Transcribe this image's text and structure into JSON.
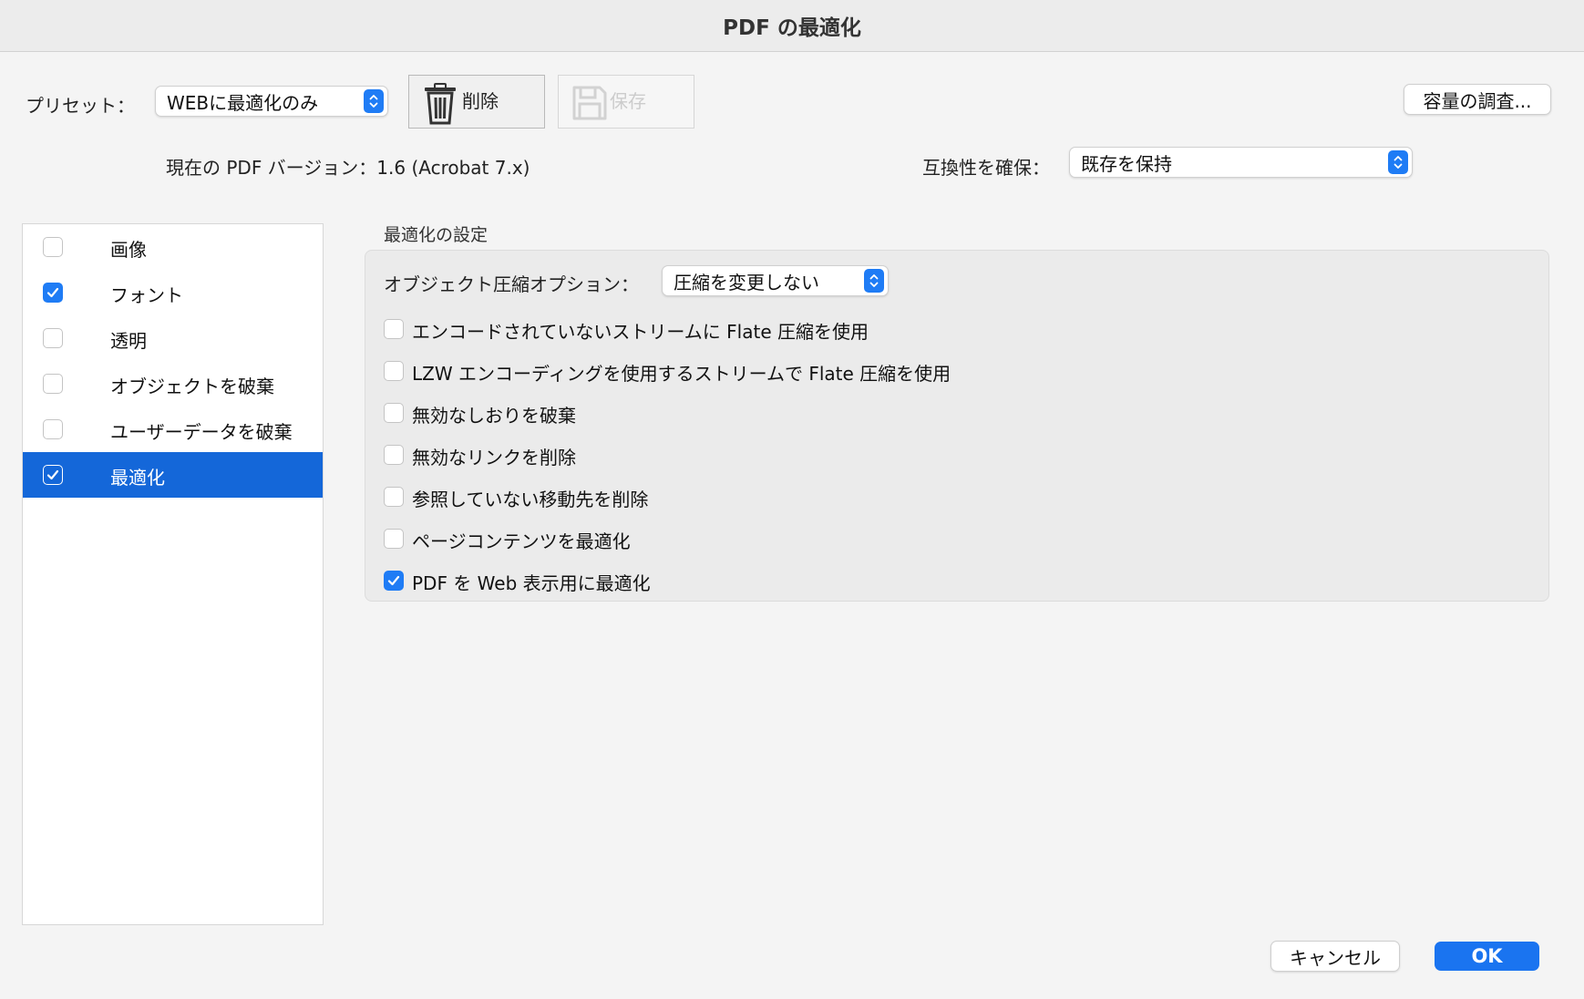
{
  "window": {
    "title": "PDF の最適化"
  },
  "preset": {
    "label": "プリセット：",
    "value": "WEBに最適化のみ"
  },
  "toolbar": {
    "delete_label": "削除",
    "save_label": "保存",
    "audit_label": "容量の調査..."
  },
  "version": {
    "text": "現在の PDF バージョン：1.6 (Acrobat 7.x)"
  },
  "compat": {
    "label": "互換性を確保：",
    "value": "既存を保持"
  },
  "sidebar": {
    "items": [
      {
        "label": "画像",
        "checked": false,
        "selected": false
      },
      {
        "label": "フォント",
        "checked": true,
        "selected": false
      },
      {
        "label": "透明",
        "checked": false,
        "selected": false
      },
      {
        "label": "オブジェクトを破棄",
        "checked": false,
        "selected": false
      },
      {
        "label": "ユーザーデータを破棄",
        "checked": false,
        "selected": false
      },
      {
        "label": "最適化",
        "checked": true,
        "selected": true
      }
    ]
  },
  "settings": {
    "heading": "最適化の設定",
    "compression_label": "オブジェクト圧縮オプション：",
    "compression_value": "圧縮を変更しない",
    "options": [
      {
        "label": "エンコードされていないストリームに Flate 圧縮を使用",
        "checked": false
      },
      {
        "label": "LZW エンコーディングを使用するストリームで Flate 圧縮を使用",
        "checked": false
      },
      {
        "label": "無効なしおりを破棄",
        "checked": false
      },
      {
        "label": "無効なリンクを削除",
        "checked": false
      },
      {
        "label": "参照していない移動先を削除",
        "checked": false
      },
      {
        "label": "ページコンテンツを最適化",
        "checked": false
      },
      {
        "label": "PDF を Web 表示用に最適化",
        "checked": true
      }
    ]
  },
  "footer": {
    "cancel_label": "キャンセル",
    "ok_label": "OK"
  },
  "colors": {
    "accent": "#1f7cf5",
    "selection": "#1467d9"
  }
}
